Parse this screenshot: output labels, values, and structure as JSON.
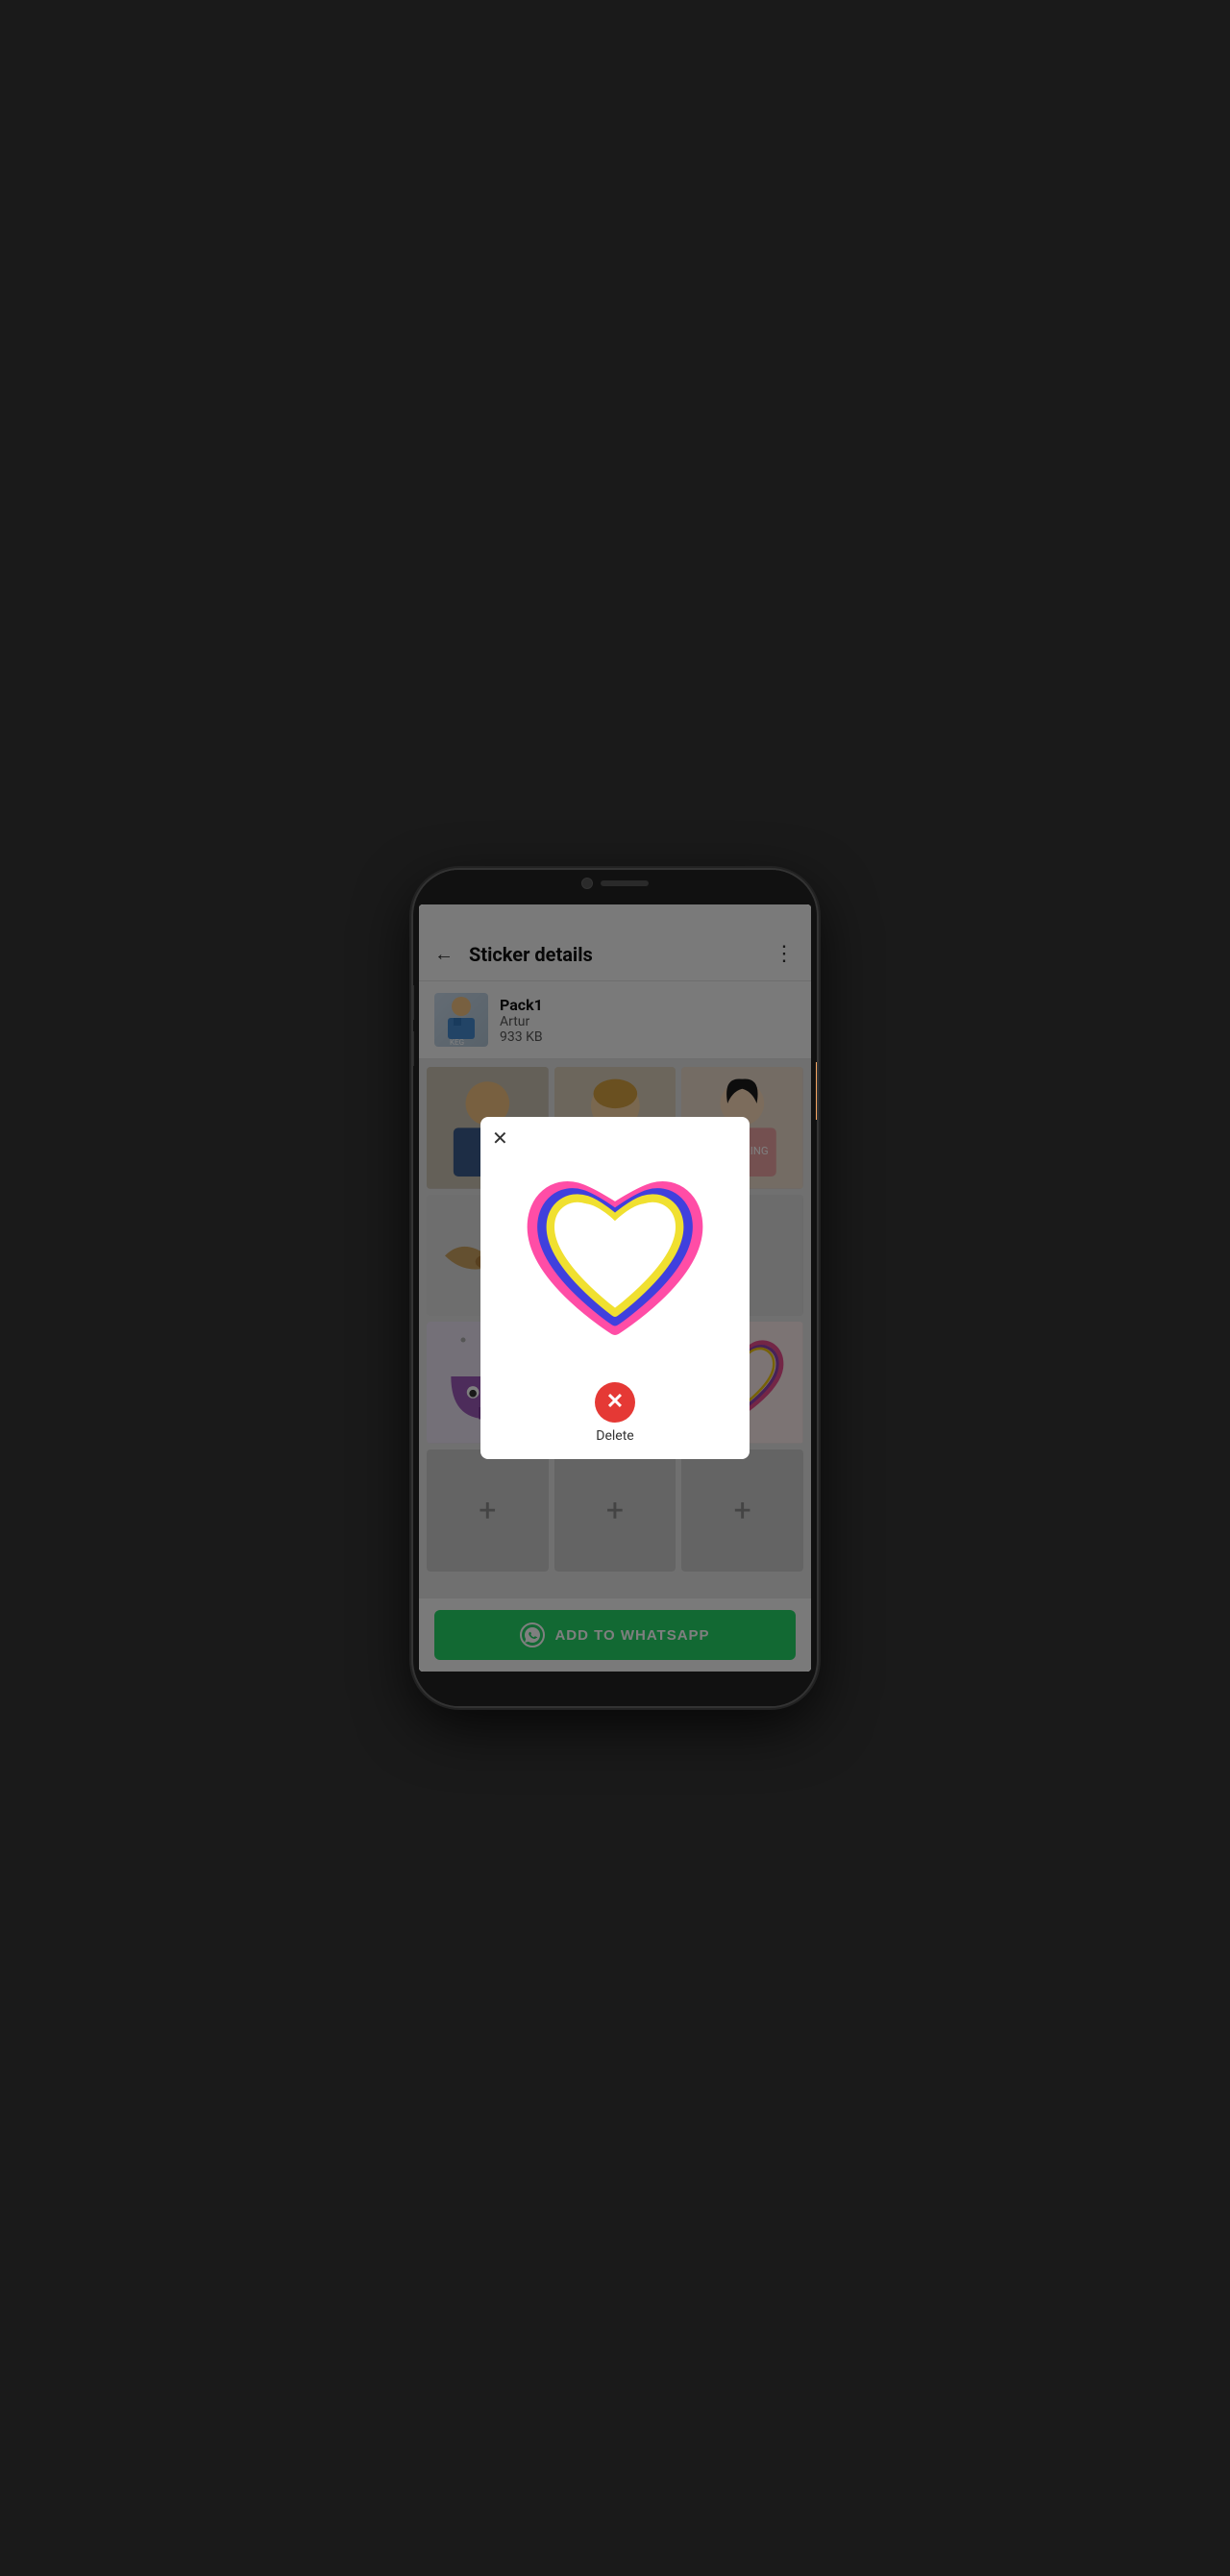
{
  "phone": {
    "status_bar": ""
  },
  "nav": {
    "back_label": "←",
    "title": "Sticker details",
    "more_label": "⋮"
  },
  "pack": {
    "name": "Pack1",
    "author": "Artur",
    "size": "933 KB"
  },
  "sticker_grid": {
    "add_icon": "+"
  },
  "modal": {
    "close_label": "✕",
    "delete_label": "Delete"
  },
  "whatsapp_button": {
    "label": "ADD TO WHATSAPP"
  }
}
